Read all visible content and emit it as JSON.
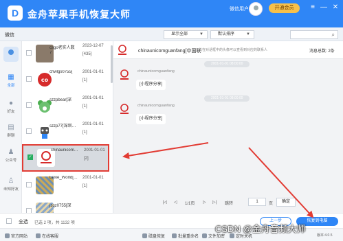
{
  "app": {
    "title": "金舟苹果手机恢复大师",
    "logo_letter": "D",
    "user_label": "微信用户",
    "member_button": "开通会员",
    "controls": [
      "≡",
      "—",
      "✕"
    ]
  },
  "toolbar": {
    "section_title": "微信",
    "filter_dropdown": "显示全部",
    "sort_dropdown": "默认排序",
    "search_placeholder": ""
  },
  "sidebar": {
    "items": [
      {
        "label": "全部",
        "icon": "grid-icon",
        "active": true
      },
      {
        "label": "好友",
        "icon": "friend-icon",
        "active": false
      },
      {
        "label": "群聊",
        "icon": "group-chat-icon",
        "active": false
      },
      {
        "label": "公众号",
        "icon": "official-account-icon",
        "active": false
      },
      {
        "label": "未知好友",
        "icon": "unknown-friend-icon",
        "active": false
      }
    ]
  },
  "contacts": [
    {
      "name": "csgo老实人数",
      "name2": "7",
      "date": "2023-12-07",
      "count": "[435]",
      "avatar": "photo-avatar"
    },
    {
      "name": "chwlgs0755[",
      "date": "2001-01-01",
      "count": "[1]",
      "avatar": "co-logo-avatar"
    },
    {
      "name": "szzpbear[深",
      "date": "2001-01-01",
      "count": "[1]",
      "avatar": "bear-avatar"
    },
    {
      "name": "szzp77[深圳…",
      "date": "2001-01-01",
      "count": "[1]",
      "avatar": "robot-avatar"
    },
    {
      "name": "chinaunicom…",
      "date": "2001-01-01",
      "count": "[2]",
      "avatar": "unicom-avatar",
      "selected": true
    },
    {
      "name": "Lexie_World[…",
      "date": "2001-01-01",
      "count": "[1]",
      "avatar": "pattern-avatar"
    },
    {
      "name": "jzqz0755[深",
      "date": "",
      "count": "",
      "avatar": "pattern-avatar"
    }
  ],
  "chat": {
    "name": "chinaunicomguanfang[中国联",
    "notice": "此在对话框中的头像可以查看到对应的联系人",
    "count_label": "消息总数: 2条",
    "messages": [
      {
        "time": "2001-01-01 08:00:00",
        "sender": "chinaunicomguanfang",
        "text": "[小程序分享]"
      },
      {
        "time": "2001-01-01 08:00:00",
        "sender": "chinaunicomguanfang",
        "text": "[小程序分享]"
      }
    ]
  },
  "pager": {
    "first": "|◁",
    "prev": "◁",
    "page_info": "1/1页",
    "next": "▷",
    "last": "▷|",
    "goto_label": "跳转",
    "page_input": "1",
    "page_unit": "页",
    "export": "确定"
  },
  "actionbar": {
    "select_all": "全选",
    "selection_info": "已选 2 项，共 1132 项",
    "prev_button": "上一步",
    "restore_button": "恢复到电脑"
  },
  "statusbar": {
    "items": [
      "官方网站",
      "在线客服",
      "磁盘恢复",
      "批量重命名",
      "文件加密",
      "定时关机"
    ],
    "version": "版本:4.0.5"
  },
  "watermark": "CSDN @金舟音频大师",
  "colors": {
    "brand": "#2f86f6",
    "highlight": "#e23b33",
    "check": "#27ae60",
    "member": "#f7c04a"
  }
}
